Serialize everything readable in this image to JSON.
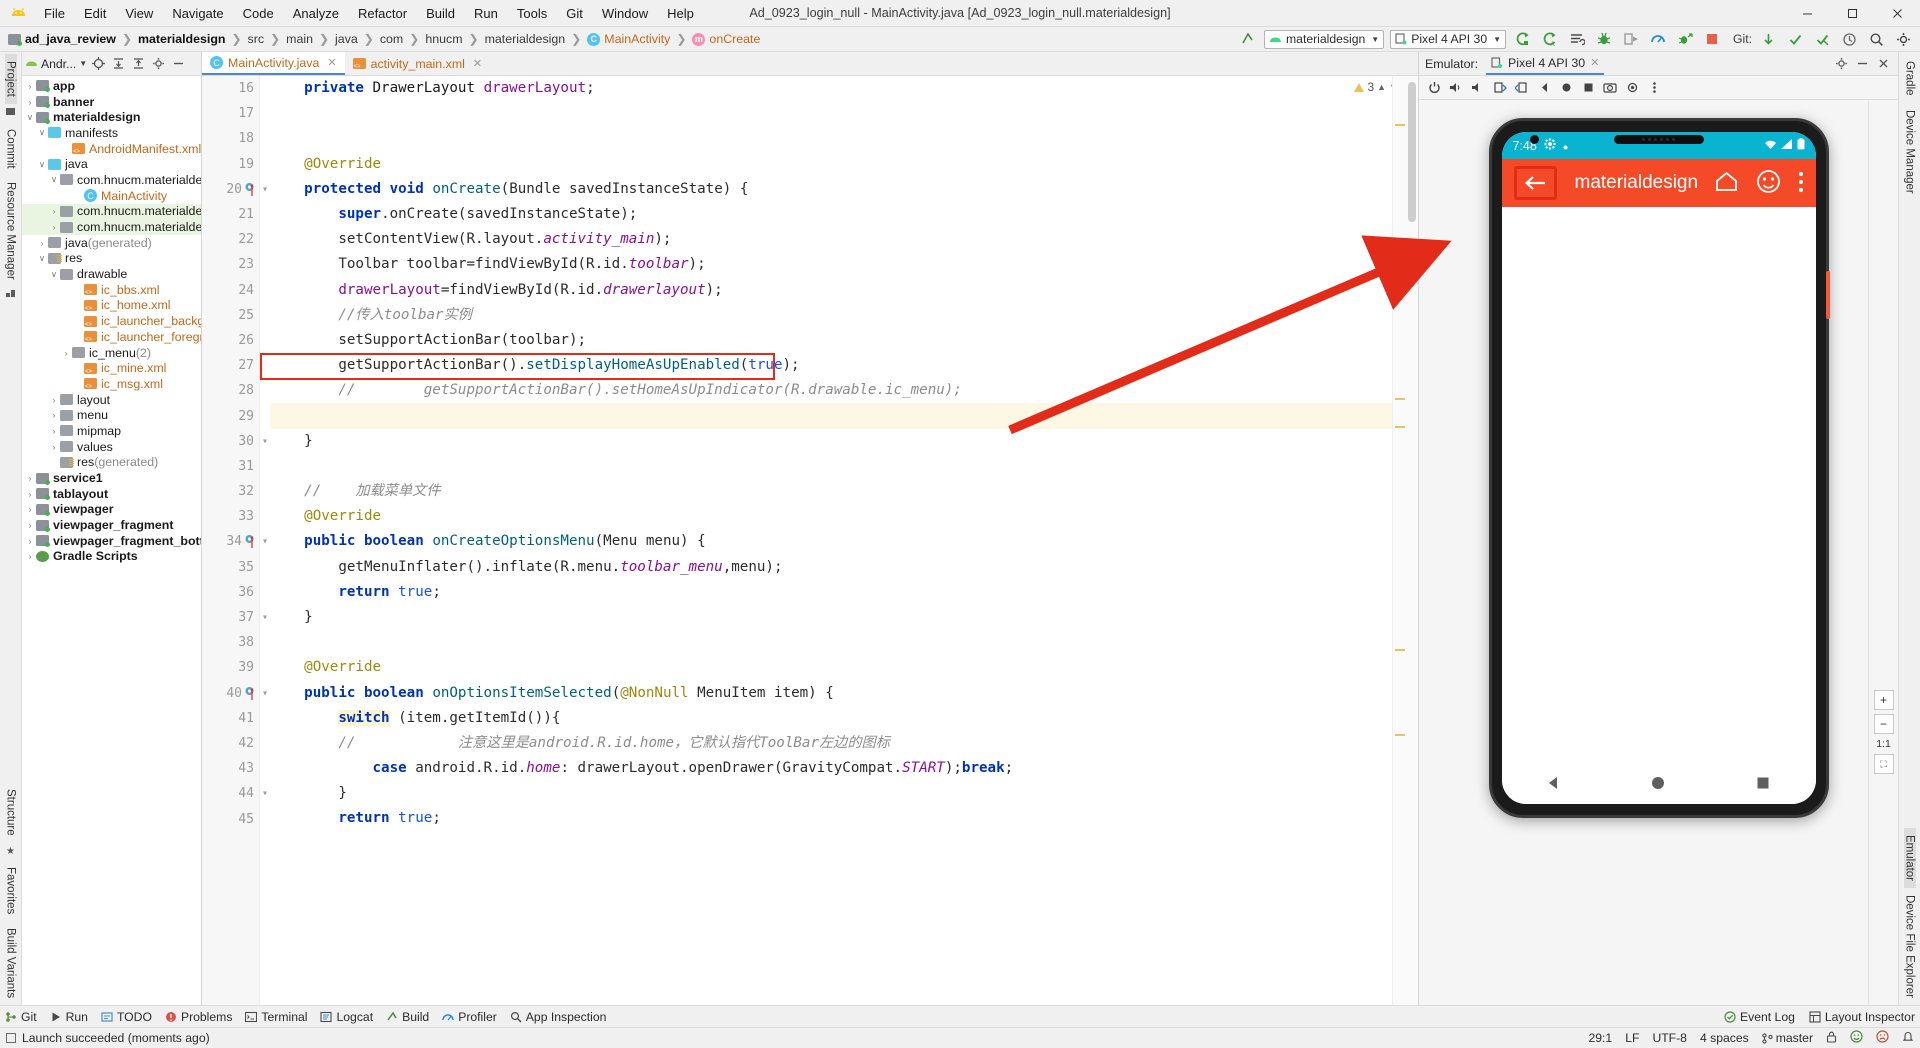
{
  "window": {
    "title": "Ad_0923_login_null - MainActivity.java [Ad_0923_login_null.materialdesign]",
    "minimize": "—",
    "maximize": "☐",
    "close": "✕"
  },
  "menubar": [
    "File",
    "Edit",
    "View",
    "Navigate",
    "Code",
    "Analyze",
    "Refactor",
    "Build",
    "Run",
    "Tools",
    "Git",
    "Window",
    "Help"
  ],
  "breadcrumb": [
    {
      "label": "ad_java_review",
      "style": "bold"
    },
    {
      "label": "materialdesign",
      "style": "bold"
    },
    {
      "label": "src",
      "style": "normal"
    },
    {
      "label": "main",
      "style": "normal"
    },
    {
      "label": "java",
      "style": "normal"
    },
    {
      "label": "com",
      "style": "normal"
    },
    {
      "label": "hnucm",
      "style": "normal"
    },
    {
      "label": "materialdesign",
      "style": "normal"
    },
    {
      "label": "MainActivity",
      "style": "class"
    },
    {
      "label": "onCreate",
      "style": "method"
    }
  ],
  "toolbar": {
    "run_config": "materialdesign",
    "device": "Pixel 4 API 30",
    "git_label": "Git:",
    "icons": [
      "sync-icon",
      "build-icon",
      "run-icon",
      "apply-changes-icon",
      "apply-code-changes-icon",
      "attach-debugger-icon",
      "debug-icon",
      "profiler-icon",
      "run-with-coverage-icon",
      "stop-icon",
      "search-icon",
      "settings-icon"
    ]
  },
  "project_panel": {
    "title": "Andr...",
    "header_icons": [
      "locate-icon",
      "expand-all-icon",
      "collapse-all-icon",
      "settings-icon",
      "hide-icon"
    ],
    "tree": [
      {
        "label": "app",
        "indent": 0,
        "twisty": "›",
        "icon": "module",
        "bold": true
      },
      {
        "label": "banner",
        "indent": 0,
        "twisty": "›",
        "icon": "module",
        "bold": true
      },
      {
        "label": "materialdesign",
        "indent": 0,
        "twisty": "∨",
        "icon": "module",
        "bold": true
      },
      {
        "label": "manifests",
        "indent": 1,
        "twisty": "∨",
        "icon": "blue-folder"
      },
      {
        "label": "AndroidManifest.xml",
        "indent": 3,
        "twisty": "",
        "icon": "xml-file",
        "color": "orange"
      },
      {
        "label": "java",
        "indent": 1,
        "twisty": "∨",
        "icon": "blue-folder"
      },
      {
        "label": "com.hnucm.materialdes",
        "indent": 2,
        "twisty": "∨",
        "icon": "package"
      },
      {
        "label": "MainActivity",
        "indent": 4,
        "twisty": "",
        "icon": "class",
        "color": "orange"
      },
      {
        "label": "com.hnucm.materialdes",
        "indent": 2,
        "twisty": "›",
        "icon": "package",
        "highlight": true
      },
      {
        "label": "com.hnucm.materialdes",
        "indent": 2,
        "twisty": "›",
        "icon": "package",
        "highlight": true
      },
      {
        "label": "java (generated)",
        "indent": 1,
        "twisty": "›",
        "icon": "gen-folder",
        "gray_suffix": true
      },
      {
        "label": "res",
        "indent": 1,
        "twisty": "∨",
        "icon": "res-folder"
      },
      {
        "label": "drawable",
        "indent": 2,
        "twisty": "∨",
        "icon": "package"
      },
      {
        "label": "ic_bbs.xml",
        "indent": 4,
        "twisty": "",
        "icon": "xml-file",
        "color": "orange"
      },
      {
        "label": "ic_home.xml",
        "indent": 4,
        "twisty": "",
        "icon": "xml-file",
        "color": "orange"
      },
      {
        "label": "ic_launcher_backgro",
        "indent": 4,
        "twisty": "",
        "icon": "xml-file",
        "color": "orange"
      },
      {
        "label": "ic_launcher_foregrou",
        "indent": 4,
        "twisty": "",
        "icon": "xml-file",
        "color": "orange"
      },
      {
        "label": "ic_menu (2)",
        "indent": 3,
        "twisty": "›",
        "icon": "package",
        "gray_suffix": true
      },
      {
        "label": "ic_mine.xml",
        "indent": 4,
        "twisty": "",
        "icon": "xml-file",
        "color": "orange"
      },
      {
        "label": "ic_msg.xml",
        "indent": 4,
        "twisty": "",
        "icon": "xml-file",
        "color": "orange"
      },
      {
        "label": "layout",
        "indent": 2,
        "twisty": "›",
        "icon": "package"
      },
      {
        "label": "menu",
        "indent": 2,
        "twisty": "›",
        "icon": "package"
      },
      {
        "label": "mipmap",
        "indent": 2,
        "twisty": "›",
        "icon": "package"
      },
      {
        "label": "values",
        "indent": 2,
        "twisty": "›",
        "icon": "package"
      },
      {
        "label": "res (generated)",
        "indent": 2,
        "twisty": "",
        "icon": "res-folder",
        "gray_suffix": true
      },
      {
        "label": "service1",
        "indent": 0,
        "twisty": "›",
        "icon": "module",
        "bold": true
      },
      {
        "label": "tablayout",
        "indent": 0,
        "twisty": "›",
        "icon": "module",
        "bold": true
      },
      {
        "label": "viewpager",
        "indent": 0,
        "twisty": "›",
        "icon": "module",
        "bold": true
      },
      {
        "label": "viewpager_fragment",
        "indent": 0,
        "twisty": "›",
        "icon": "module",
        "bold": true
      },
      {
        "label": "viewpager_fragment_bottom",
        "indent": 0,
        "twisty": "›",
        "icon": "module",
        "bold": true
      },
      {
        "label": "Gradle Scripts",
        "indent": 0,
        "twisty": "›",
        "icon": "gradle",
        "bold": true
      }
    ]
  },
  "left_rail": [
    "Project",
    "Commit",
    "Resource Manager"
  ],
  "left_rail_bottom": [
    "Structure",
    "Favorites",
    "Build Variants"
  ],
  "right_rail": [
    "Gradle",
    "Device Manager",
    "Emulator",
    "Device File Explorer"
  ],
  "editor": {
    "tabs": [
      {
        "label": "MainActivity.java",
        "icon": "java-class-icon",
        "active": true
      },
      {
        "label": "activity_main.xml",
        "icon": "xml-file-icon",
        "active": false
      }
    ],
    "warning_count": "3",
    "first_line": 16,
    "lines": [
      {
        "n": 16,
        "tokens": [
          {
            "t": "    ",
            "c": "plain"
          },
          {
            "t": "private",
            "c": "kw"
          },
          {
            "t": " DrawerLayout ",
            "c": "type"
          },
          {
            "t": "drawerLayout",
            "c": "fld"
          },
          {
            "t": ";",
            "c": "plain"
          }
        ]
      },
      {
        "n": 17,
        "tokens": []
      },
      {
        "n": 18,
        "tokens": []
      },
      {
        "n": 19,
        "tokens": [
          {
            "t": "    ",
            "c": "plain"
          },
          {
            "t": "@Override",
            "c": "ann"
          }
        ]
      },
      {
        "n": 20,
        "tokens": [
          {
            "t": "    ",
            "c": "plain"
          },
          {
            "t": "protected",
            "c": "kw"
          },
          {
            "t": " ",
            "c": "plain"
          },
          {
            "t": "void",
            "c": "kw"
          },
          {
            "t": " ",
            "c": "plain"
          },
          {
            "t": "onCreate",
            "c": "fn"
          },
          {
            "t": "(Bundle savedInstanceState) {",
            "c": "plain"
          }
        ]
      },
      {
        "n": 21,
        "tokens": [
          {
            "t": "        ",
            "c": "plain"
          },
          {
            "t": "super",
            "c": "kw"
          },
          {
            "t": ".onCreate(savedInstanceState);",
            "c": "plain"
          }
        ]
      },
      {
        "n": 22,
        "tokens": [
          {
            "t": "        setContentView(R.layout.",
            "c": "plain"
          },
          {
            "t": "activity_main",
            "c": "italicfld"
          },
          {
            "t": ");",
            "c": "plain"
          }
        ]
      },
      {
        "n": 23,
        "tokens": [
          {
            "t": "        Toolbar toolbar=findViewById(R.id.",
            "c": "plain"
          },
          {
            "t": "toolbar",
            "c": "italicfld"
          },
          {
            "t": ");",
            "c": "plain"
          }
        ]
      },
      {
        "n": 24,
        "tokens": [
          {
            "t": "        ",
            "c": "plain"
          },
          {
            "t": "drawerLayout",
            "c": "fld"
          },
          {
            "t": "=findViewById(R.id.",
            "c": "plain"
          },
          {
            "t": "drawerlayout",
            "c": "italicfld"
          },
          {
            "t": ");",
            "c": "plain"
          }
        ]
      },
      {
        "n": 25,
        "tokens": [
          {
            "t": "        //传入toolbar实例",
            "c": "cmt"
          }
        ]
      },
      {
        "n": 26,
        "tokens": [
          {
            "t": "        setSupportActionBar(toolbar);",
            "c": "plain"
          }
        ]
      },
      {
        "n": 27,
        "tokens": [
          {
            "t": "        getSupportActionBar().",
            "c": "plain"
          },
          {
            "t": "setDisplayHomeAsUpEnabled",
            "c": "fn"
          },
          {
            "t": "(",
            "c": "plain"
          },
          {
            "t": "true",
            "c": "num"
          },
          {
            "t": ");",
            "c": "plain"
          }
        ]
      },
      {
        "n": 28,
        "tokens": [
          {
            "t": "        getSupportActionBar().setHomeAsUpIndicator(R.drawable.ic_menu);",
            "c": "cmt"
          }
        ],
        "comment_prefix": "//"
      },
      {
        "n": 29,
        "tokens": [],
        "current": true
      },
      {
        "n": 30,
        "tokens": [
          {
            "t": "    }",
            "c": "plain"
          }
        ]
      },
      {
        "n": 31,
        "tokens": []
      },
      {
        "n": 32,
        "tokens": [
          {
            "t": "    //    加载菜单文件",
            "c": "cmt"
          }
        ]
      },
      {
        "n": 33,
        "tokens": [
          {
            "t": "    ",
            "c": "plain"
          },
          {
            "t": "@Override",
            "c": "ann"
          }
        ]
      },
      {
        "n": 34,
        "tokens": [
          {
            "t": "    ",
            "c": "plain"
          },
          {
            "t": "public",
            "c": "kw"
          },
          {
            "t": " ",
            "c": "plain"
          },
          {
            "t": "boolean",
            "c": "kw"
          },
          {
            "t": " ",
            "c": "plain"
          },
          {
            "t": "onCreateOptionsMenu",
            "c": "fn"
          },
          {
            "t": "(Menu menu) {",
            "c": "plain"
          }
        ]
      },
      {
        "n": 35,
        "tokens": [
          {
            "t": "        getMenuInflater().inflate(R.menu.",
            "c": "plain"
          },
          {
            "t": "toolbar_menu",
            "c": "italicfld"
          },
          {
            "t": ",menu);",
            "c": "plain"
          }
        ]
      },
      {
        "n": 36,
        "tokens": [
          {
            "t": "        ",
            "c": "plain"
          },
          {
            "t": "return",
            "c": "kw"
          },
          {
            "t": " ",
            "c": "plain"
          },
          {
            "t": "true",
            "c": "num"
          },
          {
            "t": ";",
            "c": "plain"
          }
        ]
      },
      {
        "n": 37,
        "tokens": [
          {
            "t": "    }",
            "c": "plain"
          }
        ]
      },
      {
        "n": 38,
        "tokens": []
      },
      {
        "n": 39,
        "tokens": [
          {
            "t": "    ",
            "c": "plain"
          },
          {
            "t": "@Override",
            "c": "ann"
          }
        ]
      },
      {
        "n": 40,
        "tokens": [
          {
            "t": "    ",
            "c": "plain"
          },
          {
            "t": "public",
            "c": "kw"
          },
          {
            "t": " ",
            "c": "plain"
          },
          {
            "t": "boolean",
            "c": "kw"
          },
          {
            "t": " ",
            "c": "plain"
          },
          {
            "t": "onOptionsItemSelected",
            "c": "fn"
          },
          {
            "t": "(",
            "c": "plain"
          },
          {
            "t": "@NonNull",
            "c": "ann"
          },
          {
            "t": " MenuItem item) {",
            "c": "plain"
          }
        ]
      },
      {
        "n": 41,
        "tokens": [
          {
            "t": "        ",
            "c": "plain"
          },
          {
            "t": "switch",
            "c": "kwsw"
          },
          {
            "t": " (item.getItemId()){",
            "c": "plain"
          }
        ]
      },
      {
        "n": 42,
        "tokens": [
          {
            "t": "            注意这里是android.R.id.home，它默认指代ToolBar左边的图标",
            "c": "cmt"
          }
        ],
        "comment_prefix": "//"
      },
      {
        "n": 43,
        "tokens": [
          {
            "t": "            ",
            "c": "plain"
          },
          {
            "t": "case",
            "c": "kw"
          },
          {
            "t": " android.R.id.",
            "c": "plain"
          },
          {
            "t": "home",
            "c": "italicfld"
          },
          {
            "t": ": drawerLayout.openDrawer(GravityCompat.",
            "c": "plain"
          },
          {
            "t": "START",
            "c": "italicfld"
          },
          {
            "t": ");",
            "c": "plain"
          },
          {
            "t": "break",
            "c": "kw"
          },
          {
            "t": ";",
            "c": "plain"
          }
        ]
      },
      {
        "n": 44,
        "tokens": [
          {
            "t": "        }",
            "c": "plain"
          }
        ]
      },
      {
        "n": 45,
        "tokens": [
          {
            "t": "        ",
            "c": "plain"
          },
          {
            "t": "return",
            "c": "kw"
          },
          {
            "t": " ",
            "c": "plain"
          },
          {
            "t": "true",
            "c": "num"
          },
          {
            "t": ";",
            "c": "plain"
          }
        ]
      }
    ]
  },
  "annotation": {
    "highlight_line": 27,
    "highlight_color": "#e32b19",
    "arrow_from": "code-line-27",
    "arrow_to": "emulator-up-button"
  },
  "emulator": {
    "label": "Emulator:",
    "tab": "Pixel 4 API 30",
    "toolbar_icons": [
      "power-icon",
      "volume-up-icon",
      "volume-down-icon",
      "rotate-left-icon",
      "rotate-right-icon",
      "back-icon",
      "home-icon",
      "overview-icon",
      "screenshot-icon",
      "record-icon",
      "more-icon"
    ],
    "device": {
      "status_bar": {
        "time": "7:48",
        "icons": [
          "settings-icon",
          "dot-icon"
        ],
        "right_icons": [
          "wifi-icon",
          "signal-icon",
          "battery-icon"
        ]
      },
      "app_bar": {
        "up_icon": "arrow-back-icon",
        "title": "materialdesign",
        "actions": [
          "home-icon",
          "face-icon",
          "overflow-menu-icon"
        ],
        "bg_color": "#f44a27"
      },
      "nav_bar": [
        "back-triangle-icon",
        "home-circle-icon",
        "recents-square-icon"
      ]
    },
    "zoom_controls": {
      "zoom_in": "+",
      "zoom_out": "−",
      "actual_size": "1:1",
      "fit": "⛶"
    }
  },
  "bottom_toolwindows": [
    {
      "label": "Git",
      "icon": "git-icon"
    },
    {
      "label": "Run",
      "icon": "run-icon"
    },
    {
      "label": "TODO",
      "icon": "todo-icon"
    },
    {
      "label": "Problems",
      "icon": "problems-icon"
    },
    {
      "label": "Terminal",
      "icon": "terminal-icon"
    },
    {
      "label": "Logcat",
      "icon": "logcat-icon"
    },
    {
      "label": "Build",
      "icon": "build-icon"
    },
    {
      "label": "Profiler",
      "icon": "profiler-icon"
    },
    {
      "label": "App Inspection",
      "icon": "app-inspection-icon"
    }
  ],
  "bottom_right_toolwindows": [
    {
      "label": "Event Log",
      "icon": "event-log-icon"
    },
    {
      "label": "Layout Inspector",
      "icon": "layout-inspector-icon"
    }
  ],
  "status_bar": {
    "message": "Launch succeeded (moments ago)",
    "caret": "29:1",
    "line_sep": "LF",
    "encoding": "UTF-8",
    "indent": "4 spaces",
    "branch": "master",
    "icons": [
      "lock-icon",
      "feedback-happy-icon",
      "feedback-sad-icon",
      "notifications-icon"
    ]
  }
}
